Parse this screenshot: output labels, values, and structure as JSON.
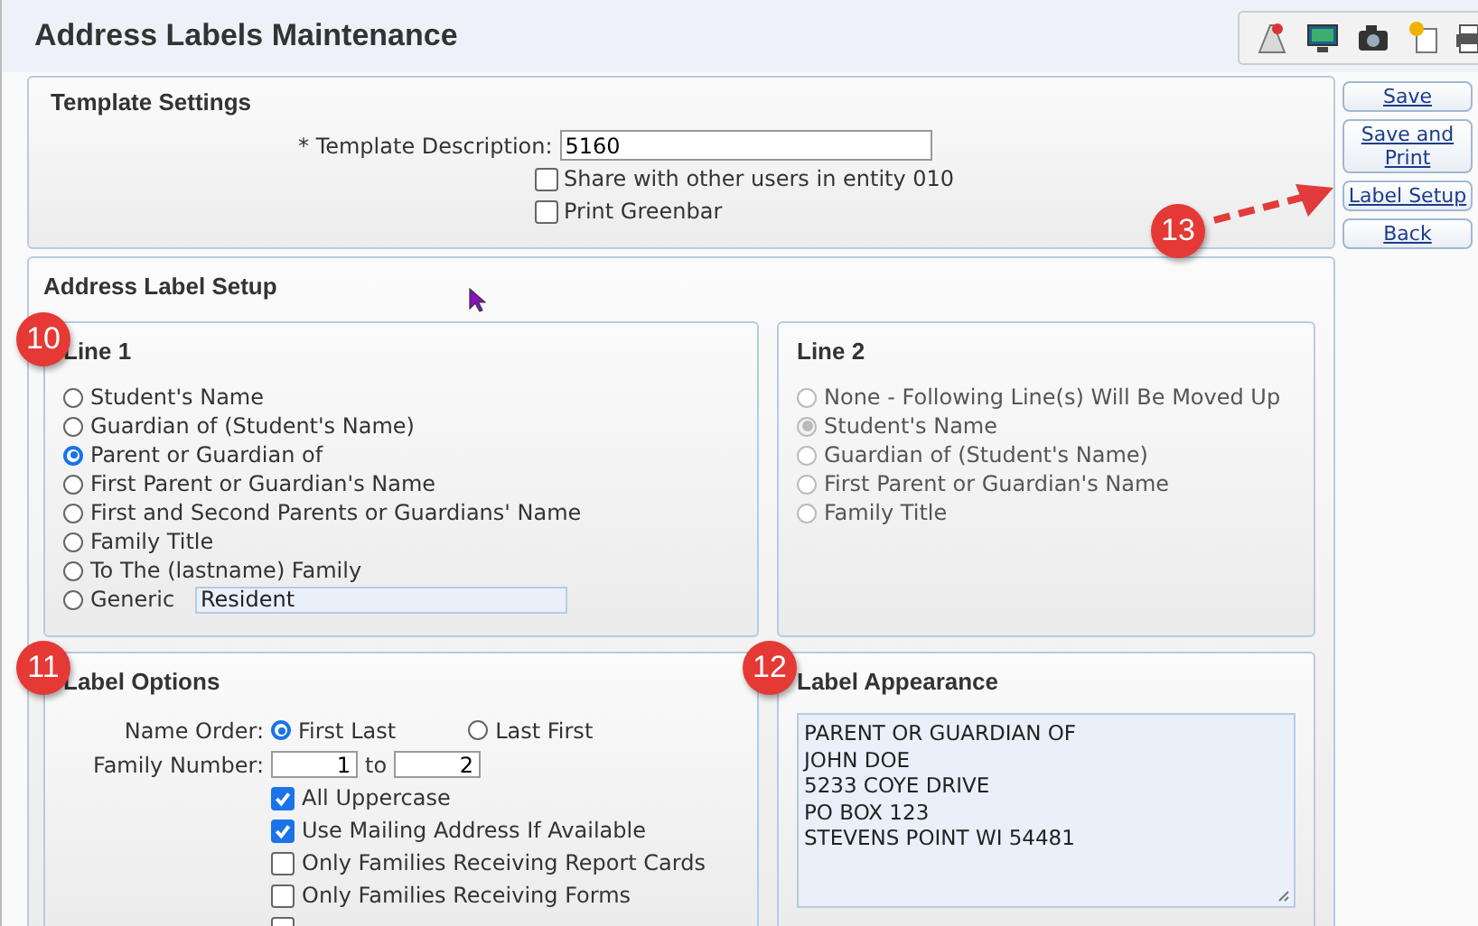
{
  "title": "Address Labels Maintenance",
  "toolbar": [
    {
      "kind": "chart"
    },
    {
      "kind": "monitor"
    },
    {
      "kind": "camera"
    },
    {
      "kind": "document"
    },
    {
      "kind": "printer"
    }
  ],
  "template_settings": {
    "heading": "Template Settings",
    "description_label": "* Template Description:",
    "description_value": "5160",
    "checkboxes": [
      {
        "label": "Share with other users in entity 010",
        "checked": false
      },
      {
        "label": "Print Greenbar",
        "checked": false
      }
    ]
  },
  "buttons": [
    {
      "label": "Save"
    },
    {
      "label": "Save and Print"
    },
    {
      "label": "Label Setup"
    },
    {
      "label": "Back"
    }
  ],
  "setup": {
    "heading": "Address Label Setup",
    "line1": {
      "heading": "Line 1",
      "badge": "10",
      "options": [
        {
          "label": "Student's Name",
          "selected": false
        },
        {
          "label": "Guardian of (Student's Name)",
          "selected": false
        },
        {
          "label": "Parent or Guardian of",
          "selected": true
        },
        {
          "label": "First Parent or Guardian's Name",
          "selected": false
        },
        {
          "label": "First and Second Parents or Guardians' Name",
          "selected": false
        },
        {
          "label": "Family Title",
          "selected": false
        },
        {
          "label": "To The (lastname) Family",
          "selected": false
        },
        {
          "label": "Generic",
          "selected": false,
          "value": "Resident"
        }
      ]
    },
    "line2": {
      "heading": "Line 2",
      "disabled": true,
      "options": [
        {
          "label": "None - Following Line(s) Will Be Moved Up",
          "selected": false
        },
        {
          "label": "Student's Name",
          "selected": true
        },
        {
          "label": "Guardian of (Student's Name)",
          "selected": false
        },
        {
          "label": "First Parent or Guardian's Name",
          "selected": false
        },
        {
          "label": "Family Title",
          "selected": false
        }
      ]
    },
    "label_options": {
      "heading": "Label Options",
      "badge": "11",
      "name_order_label": "Name Order:",
      "name_order": [
        {
          "label": "First Last",
          "selected": true
        },
        {
          "label": "Last First",
          "selected": false
        }
      ],
      "family_label": "Family Number:",
      "family_from": "1",
      "family_to_word": "to",
      "family_to": "2",
      "checkboxes": [
        {
          "label": "All Uppercase",
          "checked": true
        },
        {
          "label": "Use Mailing Address If Available",
          "checked": true
        },
        {
          "label": "Only Families Receiving Report Cards",
          "checked": false
        },
        {
          "label": "Only Families Receiving Forms",
          "checked": false
        },
        {
          "checked": false
        }
      ]
    },
    "appearance": {
      "heading": "Label Appearance",
      "badge": "12",
      "lines": [
        "PARENT OR GUARDIAN OF",
        "JOHN DOE",
        "5233 COYE DRIVE",
        "PO BOX 123",
        "STEVENS POINT WI 54481"
      ]
    }
  },
  "callout": {
    "badge": "13"
  }
}
